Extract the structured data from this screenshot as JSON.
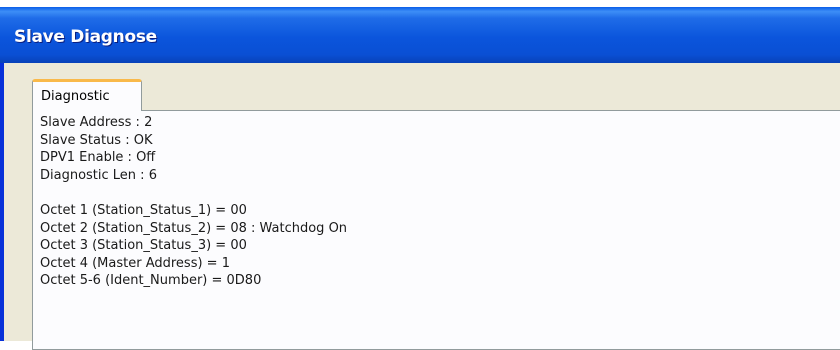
{
  "window": {
    "title": "Slave Diagnose",
    "colors": {
      "titlebar": "#0a55dc",
      "border": "#0831d9",
      "face": "#ece9d8",
      "tab_highlight": "#f9b94a",
      "panel": "#fcfcfe"
    }
  },
  "tabs": [
    {
      "label": "Diagnostic",
      "selected": true
    }
  ],
  "diagnostic": {
    "summary": [
      "Slave Address : 2",
      "Slave Status : OK",
      "DPV1 Enable : Off",
      "Diagnostic Len : 6"
    ],
    "octets": [
      "Octet 1 (Station_Status_1) = 00",
      "Octet 2 (Station_Status_2) = 08 : Watchdog On",
      "Octet 3 (Station_Status_3) = 00",
      "Octet 4 (Master Address) = 1",
      "Octet 5-6 (Ident_Number) = 0D80"
    ]
  }
}
